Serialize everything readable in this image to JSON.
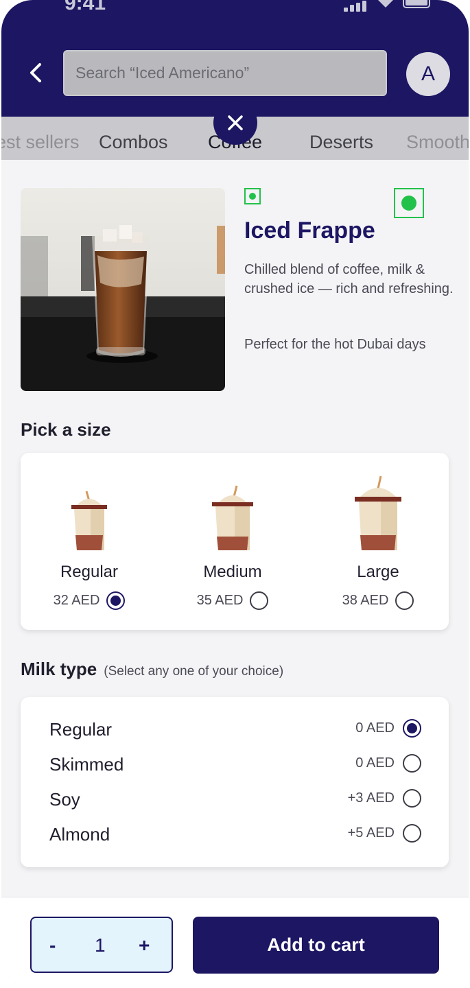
{
  "status_bar": {
    "time": "9:41"
  },
  "header": {
    "search_placeholder": "Search “Iced Americano”",
    "avatar_initial": "A"
  },
  "categories": [
    {
      "label": "Best sellers",
      "state": "faded"
    },
    {
      "label": "Combos",
      "state": "normal"
    },
    {
      "label": "Coffee",
      "state": "active"
    },
    {
      "label": "Deserts",
      "state": "normal"
    },
    {
      "label": "Smoothies",
      "state": "faded"
    }
  ],
  "product": {
    "name": "Iced Frappe",
    "description": "Chilled blend of coffee, milk & crushed ice — rich and refreshing.",
    "tagline": "Perfect for the hot Dubai days",
    "veg_indicator_color": "#22c24a"
  },
  "size_section": {
    "title": "Pick a size",
    "options": [
      {
        "label": "Regular",
        "price": "32 AED",
        "selected": true
      },
      {
        "label": "Medium",
        "price": "35 AED",
        "selected": false
      },
      {
        "label": "Large",
        "price": "38 AED",
        "selected": false
      }
    ]
  },
  "milk_section": {
    "title": "Milk type",
    "note": "(Select any one of your choice)",
    "options": [
      {
        "label": "Regular",
        "price": "0 AED",
        "selected": true
      },
      {
        "label": "Skimmed",
        "price": "0 AED",
        "selected": false
      },
      {
        "label": "Soy",
        "price": "+3 AED",
        "selected": false
      },
      {
        "label": "Almond",
        "price": "+5 AED",
        "selected": false
      }
    ]
  },
  "footer": {
    "minus": "-",
    "quantity": "1",
    "plus": "+",
    "add_to_cart": "Add to cart"
  },
  "colors": {
    "primary": "#1c1663",
    "accent_veg": "#22c24a",
    "stepper_bg": "#e3f4fc"
  }
}
